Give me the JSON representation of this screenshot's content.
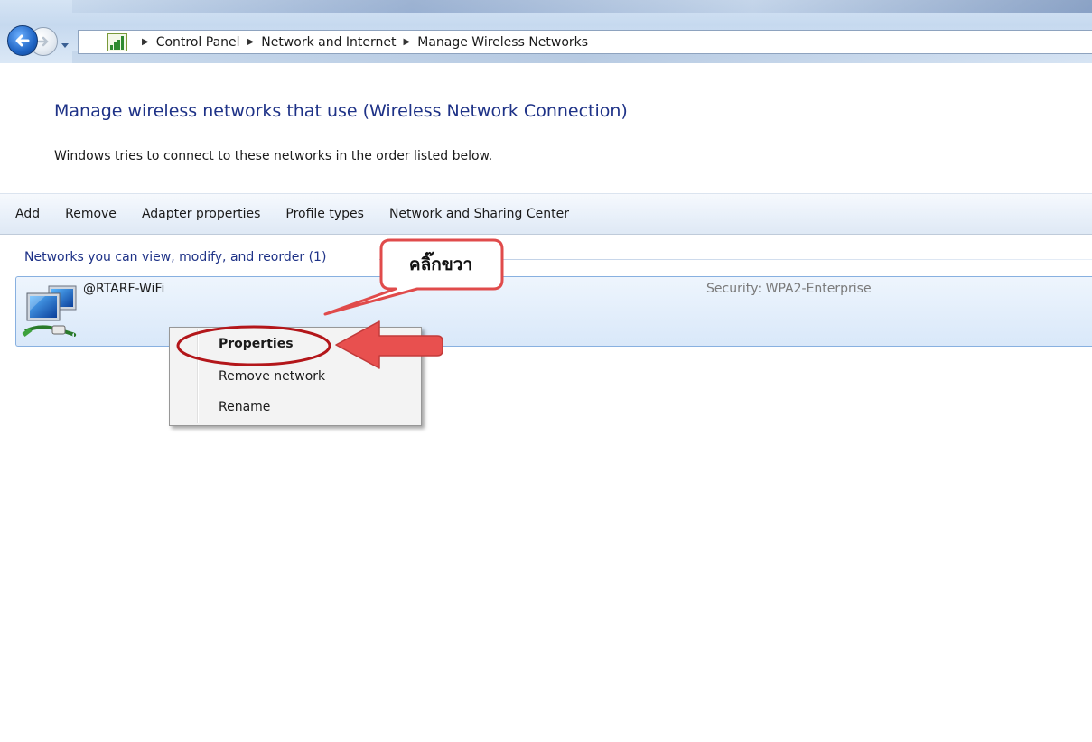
{
  "address_bar": {
    "breadcrumbs": [
      "Control Panel",
      "Network and Internet",
      "Manage Wireless Networks"
    ],
    "back_icon": "back-arrow-icon",
    "forward_icon": "forward-arrow-icon",
    "location_icon": "network-signal-icon"
  },
  "header": {
    "title": "Manage wireless networks that use (Wireless Network Connection)",
    "description": "Windows tries to connect to these networks in the order listed below."
  },
  "command_bar": {
    "add": "Add",
    "remove": "Remove",
    "adapter_properties": "Adapter properties",
    "profile_types": "Profile types",
    "network_sharing_center": "Network and Sharing Center"
  },
  "networks": {
    "group_header": "Networks you can view, modify, and reorder (1)",
    "items": [
      {
        "name": "@RTARF-WiFi",
        "security": "Security: WPA2-Enterprise",
        "icon": "wireless-network-profile-icon"
      }
    ]
  },
  "context_menu": {
    "items": [
      "Properties",
      "Remove network",
      "Rename"
    ]
  },
  "annotation": {
    "callout": "คลิ๊กขวา",
    "color": "#e04b4b"
  },
  "colors": {
    "title_blue": "#1e3287",
    "selection_blue": "#d9e8f9",
    "annotation_red": "#e04b4b"
  }
}
